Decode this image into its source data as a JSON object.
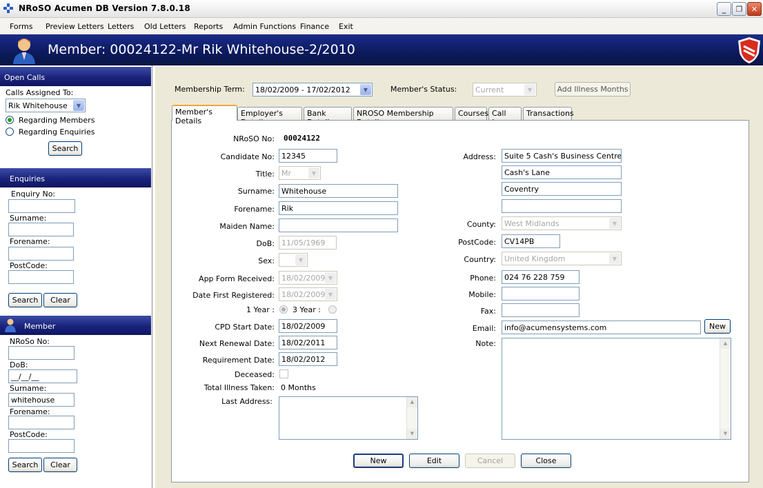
{
  "window": {
    "title": "NRoSO Acumen DB Version 7.8.0.18"
  },
  "menu": [
    "Forms",
    "Preview Letters",
    "Letters",
    "Old Letters",
    "Reports",
    "Admin Functions",
    "Finance",
    "Exit"
  ],
  "header": {
    "title": "Member: 00024122-Mr Rik Whitehouse-2/2010"
  },
  "open_calls": {
    "heading": "Open Calls",
    "assigned_label": "Calls Assigned To:",
    "assigned_value": "Rik Whitehouse",
    "radio_members": "Regarding Members",
    "radio_enquiries": "Regarding Enquiries",
    "selected": "Regarding Members",
    "search": "Search"
  },
  "enquiries": {
    "heading": "Enquiries",
    "enquiry_no": "Enquiry No:",
    "surname": "Surname:",
    "forename": "Forename:",
    "postcode": "PostCode:",
    "search": "Search",
    "clear": "Clear"
  },
  "member_search": {
    "heading": "Member",
    "nroso_no": "NRoSo No:",
    "dob": "DoB:",
    "dob_value": "__/__/__",
    "surname": "Surname:",
    "surname_value": "whitehouse",
    "forename": "Forename:",
    "postcode": "PostCode:",
    "search": "Search",
    "clear": "Clear"
  },
  "top": {
    "term_label": "Membership Term:",
    "term_value": "18/02/2009 - 17/02/2012",
    "status_label": "Member's Status:",
    "status_value": "Current",
    "add_illness": "Add Illness Months"
  },
  "tabs": [
    "Member's Details",
    "Employer's Details",
    "Bank Details",
    "NROSO Membership Details",
    "Courses",
    "Call Log",
    "Transactions"
  ],
  "active_tab": "Member's Details",
  "details": {
    "nroso_no_label": "NRoSO No:",
    "nroso_no": "00024122",
    "candidate_label": "Candidate No:",
    "candidate": "12345",
    "title_label": "Title:",
    "title": "Mr",
    "surname_label": "Surname:",
    "surname": "Whitehouse",
    "forename_label": "Forename:",
    "forename": "Rik",
    "maiden_label": "Maiden Name:",
    "maiden": "",
    "dob_label": "DoB:",
    "dob": "11/05/1969",
    "sex_label": "Sex:",
    "sex": "",
    "app_form_label": "App Form Received:",
    "app_form": "18/02/2009",
    "first_reg_label": "Date First Registered:",
    "first_reg": "18/02/2009",
    "one_year": "1 Year :",
    "three_year": "3 Year :",
    "cpd_label": "CPD Start Date:",
    "cpd": "18/02/2009",
    "renewal_label": "Next Renewal Date:",
    "renewal": "18/02/2011",
    "requirement_label": "Requirement Date:",
    "requirement": "18/02/2012",
    "deceased_label": "Deceased:",
    "illness_label": "Total Illness Taken:",
    "illness": "0 Months",
    "last_address_label": "Last Address:",
    "address_label": "Address:",
    "address1": "Suite 5 Cash's Business Centre",
    "address2": "Cash's Lane",
    "address3": "Coventry",
    "address4": "",
    "county_label": "County:",
    "county": "West Midlands",
    "postcode_label": "PostCode:",
    "postcode": "CV14PB",
    "country_label": "Country:",
    "country": "United Kingdom",
    "phone_label": "Phone:",
    "phone": "024 76 228 759",
    "mobile_label": "Mobile:",
    "mobile": "",
    "fax_label": "Fax:",
    "fax": "",
    "email_label": "Email:",
    "email": "info@acumensystems.com",
    "email_new": "New",
    "note_label": "Note:"
  },
  "actions": {
    "new": "New",
    "edit": "Edit",
    "cancel": "Cancel",
    "close": "Close"
  }
}
